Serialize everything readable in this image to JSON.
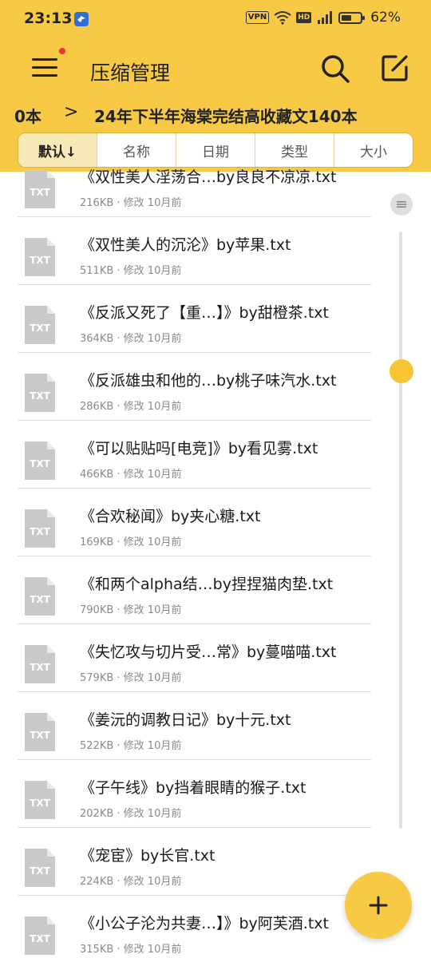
{
  "status_bar": {
    "time": "23:13",
    "vpn": "VPN",
    "hd": "HD",
    "battery": "62%"
  },
  "app_bar": {
    "title": "压缩管理"
  },
  "breadcrumb": {
    "previous": "0本",
    "separator": ">",
    "current": "24年下半年海棠完结高收藏文140本"
  },
  "sort_tabs": [
    "默认↓",
    "名称",
    "日期",
    "类型",
    "大小"
  ],
  "file_icon_label": "TXT",
  "files": [
    {
      "name": "《双性美人淫荡合…by良良不凉凉.txt",
      "size": "216KB",
      "modified": "修改 10月前"
    },
    {
      "name": "《双性美人的沉沦》by苹果.txt",
      "size": "511KB",
      "modified": "修改 10月前"
    },
    {
      "name": "《反派又死了【重…】》by甜橙茶.txt",
      "size": "364KB",
      "modified": "修改 10月前"
    },
    {
      "name": "《反派雄虫和他的…by桃子味汽水.txt",
      "size": "286KB",
      "modified": "修改 10月前"
    },
    {
      "name": "《可以贴贴吗[电竞]》by看见雾.txt",
      "size": "466KB",
      "modified": "修改 10月前"
    },
    {
      "name": "《合欢秘闻》by夹心糖.txt",
      "size": "169KB",
      "modified": "修改 10月前"
    },
    {
      "name": "《和两个alpha结…by捏捏猫肉垫.txt",
      "size": "790KB",
      "modified": "修改 10月前"
    },
    {
      "name": "《失忆攻与切片受…常》by蔓喵喵.txt",
      "size": "579KB",
      "modified": "修改 10月前"
    },
    {
      "name": "《姜沅的调教日记》by十元.txt",
      "size": "522KB",
      "modified": "修改 10月前"
    },
    {
      "name": "《子午线》by挡着眼睛的猴子.txt",
      "size": "202KB",
      "modified": "修改 10月前"
    },
    {
      "name": "《宠宦》by长官.txt",
      "size": "224KB",
      "modified": "修改 10月前"
    },
    {
      "name": "《小公子沦为共妻…】》by阿芙酒.txt",
      "size": "315KB",
      "modified": "修改 10月前"
    }
  ],
  "colors": {
    "accent": "#f7c945",
    "notification_dot": "#e53935"
  }
}
